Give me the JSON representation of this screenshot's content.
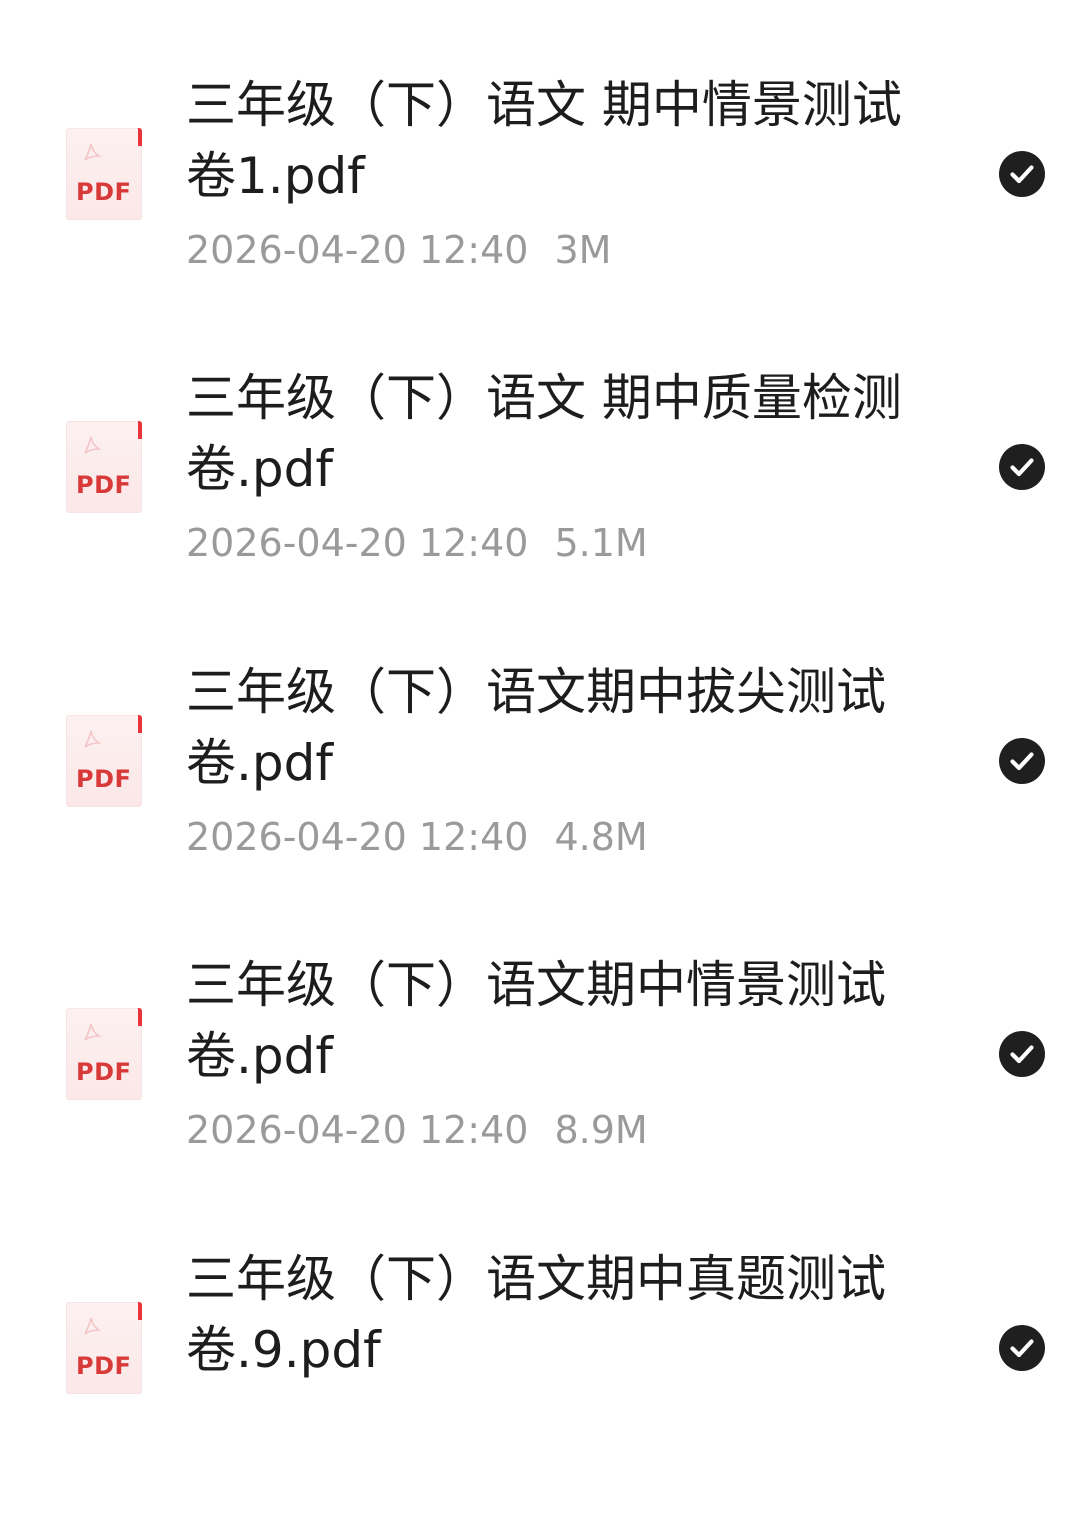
{
  "files": [
    {
      "icon_label": "PDF",
      "name": "三年级（下）语文 期中情景测试卷1.pdf",
      "date": "2026-04-20 12:40",
      "size": "3M",
      "selected": true
    },
    {
      "icon_label": "PDF",
      "name": "三年级（下）语文 期中质量检测卷.pdf",
      "date": "2026-04-20 12:40",
      "size": "5.1M",
      "selected": true
    },
    {
      "icon_label": "PDF",
      "name": "三年级（下）语文期中拔尖测试卷.pdf",
      "date": "2026-04-20 12:40",
      "size": "4.8M",
      "selected": true
    },
    {
      "icon_label": "PDF",
      "name": "三年级（下）语文期中情景测试卷.pdf",
      "date": "2026-04-20 12:40",
      "size": "8.9M",
      "selected": true
    },
    {
      "icon_label": "PDF",
      "name": "三年级（下）语文期中真题测试卷.9.pdf",
      "date": "",
      "size": "",
      "selected": true
    }
  ],
  "colors": {
    "pdf_red": "#d83a3a",
    "name_text": "#1d1d1d",
    "meta_text": "#9a9a9a",
    "check_bg": "#1f1f1f"
  },
  "icons": {
    "file": "pdf-file-icon",
    "selected": "checkmark-circle-icon"
  }
}
